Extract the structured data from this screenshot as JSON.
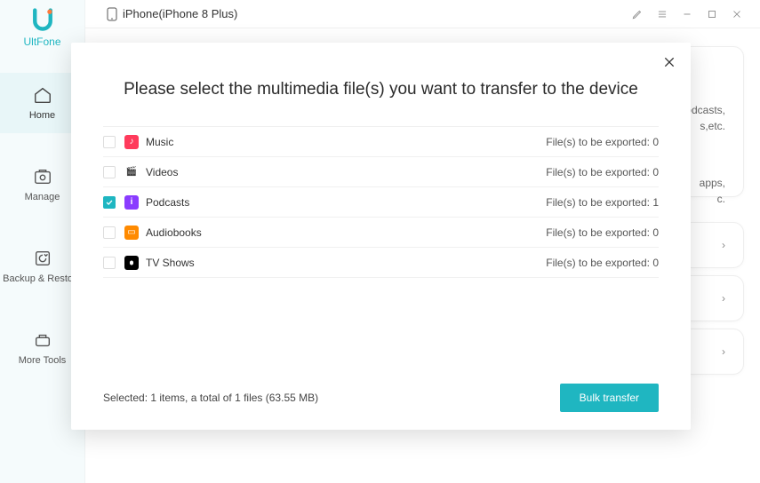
{
  "brand": {
    "name": "UltFone"
  },
  "titlebar": {
    "device": "iPhone(iPhone 8 Plus)"
  },
  "sidebar": {
    "items": [
      {
        "label": "Home"
      },
      {
        "label": "Manage"
      },
      {
        "label": "Backup & Restore"
      },
      {
        "label": "More Tools"
      }
    ]
  },
  "background": {
    "snippet1a": "odcasts,",
    "snippet1b": "s,etc.",
    "snippet2a": "apps,",
    "snippet2b": "c."
  },
  "modal": {
    "title": "Please select the multimedia file(s) you want to transfer to the device",
    "rows": [
      {
        "label": "Music",
        "count_label": "File(s) to be exported: 0",
        "checked": false,
        "icon_bg": "#ff3b5c",
        "glyph": "♪"
      },
      {
        "label": "Videos",
        "count_label": "File(s) to be exported: 0",
        "checked": false,
        "icon_bg": "#ffffff",
        "glyph": "🎬"
      },
      {
        "label": "Podcasts",
        "count_label": "File(s) to be exported: 1",
        "checked": true,
        "icon_bg": "#8a3cff",
        "glyph": "i"
      },
      {
        "label": "Audiobooks",
        "count_label": "File(s) to be exported: 0",
        "checked": false,
        "icon_bg": "#ff8a00",
        "glyph": "▭"
      },
      {
        "label": "TV Shows",
        "count_label": "File(s) to be exported: 0",
        "checked": false,
        "icon_bg": "#000000",
        "glyph": ""
      }
    ],
    "summary": "Selected: 1 items, a total of 1 files (63.55 MB)",
    "button": "Bulk transfer"
  }
}
